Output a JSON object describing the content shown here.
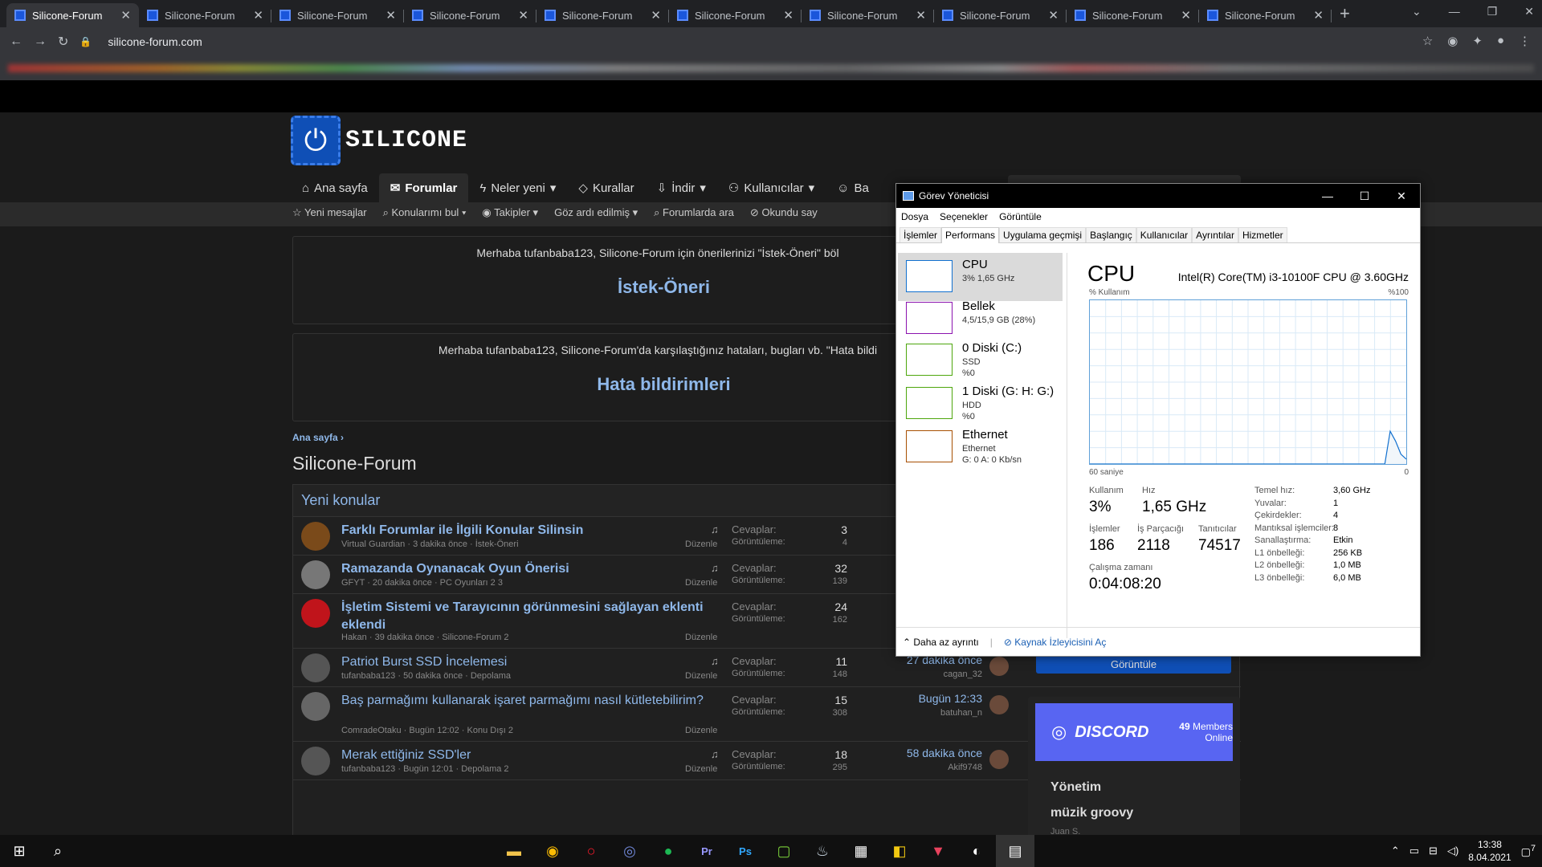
{
  "browser": {
    "tabs": [
      "Silicone-Forum",
      "Silicone-Forum",
      "Silicone-Forum",
      "Silicone-Forum",
      "Silicone-Forum",
      "Silicone-Forum",
      "Silicone-Forum",
      "Silicone-Forum",
      "Silicone-Forum",
      "Silicone-Forum"
    ],
    "url": "silicone-forum.com"
  },
  "site": {
    "logo_text": "SILICONE",
    "nav": [
      "Ana sayfa",
      "Forumlar",
      "Neler yeni",
      "Kurallar",
      "İndir",
      "Kullanıcılar",
      "Ba"
    ],
    "subnav": [
      "Yeni mesajlar",
      "Konularımı bul",
      "Takipler",
      "Göz ardı edilmiş",
      "Forumlarda ara",
      "Okundu say"
    ],
    "notice1": {
      "text": "Merhaba tufanbaba123, Silicone-Forum için önerilerinizi \"İstek-Öneri\" böl",
      "title": "İstek-Öneri"
    },
    "notice2": {
      "text": "Merhaba tufanbaba123, Silicone-Forum'da karşılaştığınız hataları, bugları vb. \"Hata bildi",
      "title": "Hata bildirimleri"
    },
    "breadcrumb": "Ana sayfa",
    "page_title": "Silicone-Forum",
    "threads_title": "Yeni konular",
    "labels": {
      "replies": "Cevaplar:",
      "views": "Görüntüleme:",
      "edit": "Düzenle"
    },
    "threads": [
      {
        "title": "Farklı Forumlar ile İlgili Konular Silinsin",
        "meta": "Virtual Guardian · 3 dakika önce · İstek-Öneri",
        "replies": "3",
        "views": "4",
        "last": "",
        "last_user": ""
      },
      {
        "title": "Ramazanda Oynanacak Oyun Önerisi",
        "meta": "GFYT · 20 dakika önce · PC Oyunları  2  3",
        "replies": "32",
        "views": "139",
        "last": "",
        "last_user": ""
      },
      {
        "title": "İşletim Sistemi ve Tarayıcının görünmesini sağlayan eklenti eklendi",
        "meta": "Hakan · 39 dakika önce · Silicone-Forum  2",
        "replies": "24",
        "views": "162",
        "last": "",
        "last_user": ""
      },
      {
        "title": "Patriot Burst SSD İncelemesi",
        "meta": "tufanbaba123 · 50 dakika önce · Depolama",
        "replies": "11",
        "views": "148",
        "last": "27 dakika önce",
        "last_user": "cagan_32"
      },
      {
        "title": "Baş parmağımı kullanarak işaret parmağımı nasıl kütletebilirim?",
        "meta": "ComradeOtaku · Bugün 12:02 · Konu Dışı  2",
        "replies": "15",
        "views": "308",
        "last": "Bugün 12:33",
        "last_user": "batuhan_n"
      },
      {
        "title": "Merak ettiğiniz SSD'ler",
        "meta": "tufanbaba123 · Bugün 12:01 · Depolama  2",
        "replies": "18",
        "views": "295",
        "last": "58 dakika önce",
        "last_user": "Akif9748"
      }
    ],
    "sidebar_button": "Görüntüle",
    "discord": {
      "logo": "DISCORD",
      "count": "49",
      "count_label": "Members Online",
      "channel1": "Yönetim",
      "channel2": "müzik groovy",
      "user": "Juan S."
    }
  },
  "taskmgr": {
    "title": "Görev Yöneticisi",
    "menu": [
      "Dosya",
      "Seçenekler",
      "Görüntüle"
    ],
    "tabs": [
      "İşlemler",
      "Performans",
      "Uygulama geçmişi",
      "Başlangıç",
      "Kullanıcılar",
      "Ayrıntılar",
      "Hizmetler"
    ],
    "resources": [
      {
        "name": "CPU",
        "sub1": "3% 1,65 GHz",
        "sub2": "",
        "color": "#1170cf"
      },
      {
        "name": "Bellek",
        "sub1": "4,5/15,9 GB (28%)",
        "sub2": "",
        "color": "#8b12ae"
      },
      {
        "name": "0 Diski (C:)",
        "sub1": "SSD",
        "sub2": "%0",
        "color": "#4da60c"
      },
      {
        "name": "1 Diski (G: H: G:)",
        "sub1": "HDD",
        "sub2": "%0",
        "color": "#4da60c"
      },
      {
        "name": "Ethernet",
        "sub1": "Ethernet",
        "sub2": "G: 0 A: 0 Kb/sn",
        "color": "#a74f01"
      }
    ],
    "cpu": {
      "title": "CPU",
      "model": "Intel(R) Core(TM) i3-10100F CPU @ 3.60GHz",
      "axis_top_left": "% Kullanım",
      "axis_top_right": "%100",
      "axis_bottom_left": "60 saniye",
      "axis_bottom_right": "0",
      "usage_label": "Kullanım",
      "usage": "3%",
      "speed_label": "Hız",
      "speed": "1,65 GHz",
      "proc_label": "İşlemler",
      "proc": "186",
      "threads_label": "İş Parçacığı",
      "threads": "2118",
      "handles_label": "Tanıtıcılar",
      "handles": "74517",
      "uptime_label": "Çalışma zamanı",
      "uptime": "0:04:08:20",
      "specs": [
        {
          "k": "Temel hız:",
          "v": "3,60 GHz"
        },
        {
          "k": "Yuvalar:",
          "v": "1"
        },
        {
          "k": "Çekirdekler:",
          "v": "4"
        },
        {
          "k": "Mantıksal işlemciler:",
          "v": "8"
        },
        {
          "k": "Sanallaştırma:",
          "v": "Etkin"
        },
        {
          "k": "L1 önbelleği:",
          "v": "256 KB"
        },
        {
          "k": "L2 önbelleği:",
          "v": "1,0 MB"
        },
        {
          "k": "L3 önbelleği:",
          "v": "6,0 MB"
        }
      ],
      "usage_history": [
        0,
        0,
        0,
        0,
        0,
        0,
        0,
        0,
        0,
        0,
        0,
        0,
        0,
        0,
        0,
        0,
        0,
        0,
        0,
        0,
        0,
        0,
        0,
        0,
        0,
        0,
        0,
        0,
        0,
        0,
        0,
        0,
        0,
        0,
        0,
        0,
        0,
        0,
        0,
        0,
        0,
        0,
        0,
        0,
        0,
        0,
        0,
        0,
        0,
        0,
        0,
        0,
        0,
        0,
        0,
        0,
        20,
        14,
        6,
        3
      ]
    },
    "footer_less": "Daha az ayrıntı",
    "footer_link": "Kaynak İzleyicisini Aç"
  },
  "taskbar": {
    "time": "13:38",
    "date": "8.04.2021",
    "notif": "7"
  }
}
